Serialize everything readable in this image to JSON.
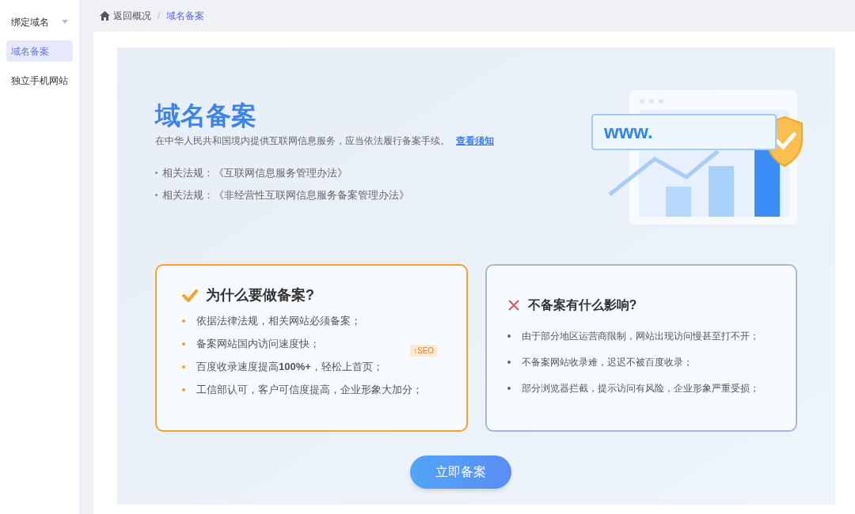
{
  "sidebar": {
    "items": [
      {
        "label": "绑定域名",
        "selected": false,
        "has_caret": true
      },
      {
        "label": "域名备案",
        "selected": true,
        "has_caret": false
      },
      {
        "label": "独立手机网站",
        "selected": false,
        "has_caret": false
      }
    ]
  },
  "breadcrumb": {
    "back": "返回概况",
    "separator": "/",
    "current": "域名备案"
  },
  "hero": {
    "title": "域名备案",
    "description": "在中华人民共和国境内提供互联网信息服务，应当依法履行备案手续。",
    "link": "查看须知",
    "laws": [
      "相关法规：《互联网信息服务管理办法》",
      "相关法规：《非经营性互联网信息服务备案管理办法》"
    ],
    "illustration_text": "www."
  },
  "cards": [
    {
      "kind": "positive",
      "title": "为什么要做备案?",
      "tag": "↑SEO",
      "items": [
        "依据法律法规，相关网站必须备案；",
        "备案网站国内访问速度快；",
        "百度收录速度提高**100%+**，轻松上首页；",
        "工信部认可，客户可信度提高，企业形象大加分；"
      ]
    },
    {
      "kind": "negative",
      "title": "不备案有什么影响?",
      "items": [
        "由于部分地区运营商限制，网站出现访问慢甚至打不开；",
        "不备案网站收录难，迟迟不被百度收录；",
        "部分浏览器拦截，提示访问有风险，企业形象严重受损；"
      ]
    }
  ],
  "action_button": "立即备案"
}
